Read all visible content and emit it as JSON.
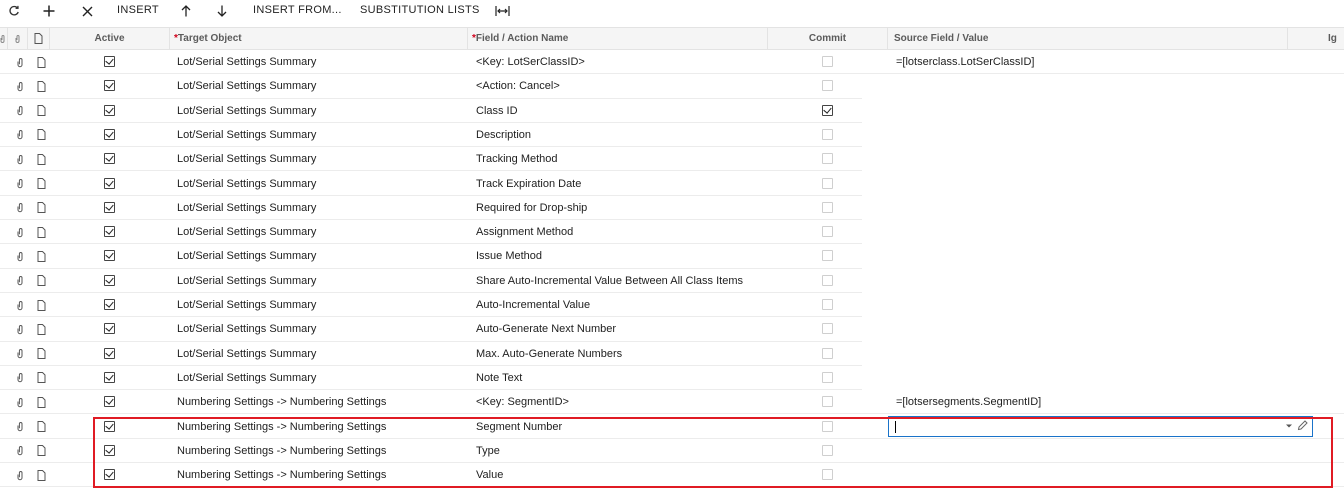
{
  "toolbar": {
    "refresh_icon": "refresh-icon",
    "add_icon": "plus-icon",
    "delete_icon": "close-icon",
    "insert_label": "INSERT",
    "up_icon": "arrow-up-icon",
    "down_icon": "arrow-down-icon",
    "insert_from_label": "INSERT FROM...",
    "substitution_lists_label": "SUBSTITUTION LISTS",
    "fit_columns_icon": "fit-columns-icon"
  },
  "header": {
    "active": "Active",
    "target_object": "Target Object",
    "field_action": "Field / Action Name",
    "commit": "Commit",
    "source_field": "Source Field / Value",
    "ignore_truncated": "Ig"
  },
  "rows": [
    {
      "active": true,
      "target": "Lot/Serial Settings Summary",
      "field": "<Key: LotSerClassID>",
      "commit": false,
      "source": "=[lotserclass.LotSerClassID]"
    },
    {
      "active": true,
      "target": "Lot/Serial Settings Summary",
      "field": "<Action: Cancel>",
      "commit": false,
      "source": ""
    },
    {
      "active": true,
      "target": "Lot/Serial Settings Summary",
      "field": "Class ID",
      "commit": true,
      "source": ""
    },
    {
      "active": true,
      "target": "Lot/Serial Settings Summary",
      "field": "Description",
      "commit": false,
      "source": ""
    },
    {
      "active": true,
      "target": "Lot/Serial Settings Summary",
      "field": "Tracking Method",
      "commit": false,
      "source": ""
    },
    {
      "active": true,
      "target": "Lot/Serial Settings Summary",
      "field": "Track Expiration Date",
      "commit": false,
      "source": ""
    },
    {
      "active": true,
      "target": "Lot/Serial Settings Summary",
      "field": "Required for Drop-ship",
      "commit": false,
      "source": ""
    },
    {
      "active": true,
      "target": "Lot/Serial Settings Summary",
      "field": "Assignment Method",
      "commit": false,
      "source": ""
    },
    {
      "active": true,
      "target": "Lot/Serial Settings Summary",
      "field": "Issue Method",
      "commit": false,
      "source": ""
    },
    {
      "active": true,
      "target": "Lot/Serial Settings Summary",
      "field": "Share Auto-Incremental Value Between All Class Items",
      "commit": false,
      "source": ""
    },
    {
      "active": true,
      "target": "Lot/Serial Settings Summary",
      "field": "Auto-Incremental Value",
      "commit": false,
      "source": ""
    },
    {
      "active": true,
      "target": "Lot/Serial Settings Summary",
      "field": "Auto-Generate Next Number",
      "commit": false,
      "source": ""
    },
    {
      "active": true,
      "target": "Lot/Serial Settings Summary",
      "field": "Max. Auto-Generate Numbers",
      "commit": false,
      "source": ""
    },
    {
      "active": true,
      "target": "Lot/Serial Settings Summary",
      "field": "Note Text",
      "commit": false,
      "source": ""
    },
    {
      "active": true,
      "target": "Numbering Settings -> Numbering Settings",
      "field": "<Key: SegmentID>",
      "commit": false,
      "source": "=[lotsersegments.SegmentID]"
    },
    {
      "active": true,
      "target": "Numbering Settings -> Numbering Settings",
      "field": "Segment Number",
      "commit": false,
      "source": "",
      "editing": true
    },
    {
      "active": true,
      "target": "Numbering Settings -> Numbering Settings",
      "field": "Type",
      "commit": false,
      "source": ""
    },
    {
      "active": true,
      "target": "Numbering Settings -> Numbering Settings",
      "field": "Value",
      "commit": false,
      "source": ""
    }
  ],
  "colors": {
    "required_marker": "#d0021b",
    "selection_border": "#e01b24",
    "edit_border": "#1a73c9"
  }
}
